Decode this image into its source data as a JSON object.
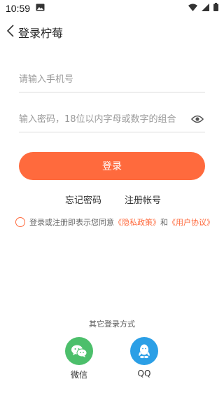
{
  "status_bar": {
    "time": "10:59"
  },
  "header": {
    "title": "登录柠莓"
  },
  "form": {
    "phone_placeholder": "请输入手机号",
    "password_placeholder": "输入密码，18位以内字母或数字的组合",
    "login_label": "登录"
  },
  "links": {
    "forgot": "忘记密码",
    "register": "注册帐号"
  },
  "agreement": {
    "prefix": "登录或注册即表示您同意",
    "privacy": "《隐私政策》",
    "and": "和",
    "terms": "《用户协议》"
  },
  "other_login": {
    "title": "其它登录方式",
    "options": [
      {
        "label": "微信",
        "icon": "wechat-icon",
        "color": "#4cbf6b"
      },
      {
        "label": "QQ",
        "icon": "qq-icon",
        "color": "#2b9fe6"
      }
    ]
  },
  "colors": {
    "accent": "#ff6a3d"
  }
}
